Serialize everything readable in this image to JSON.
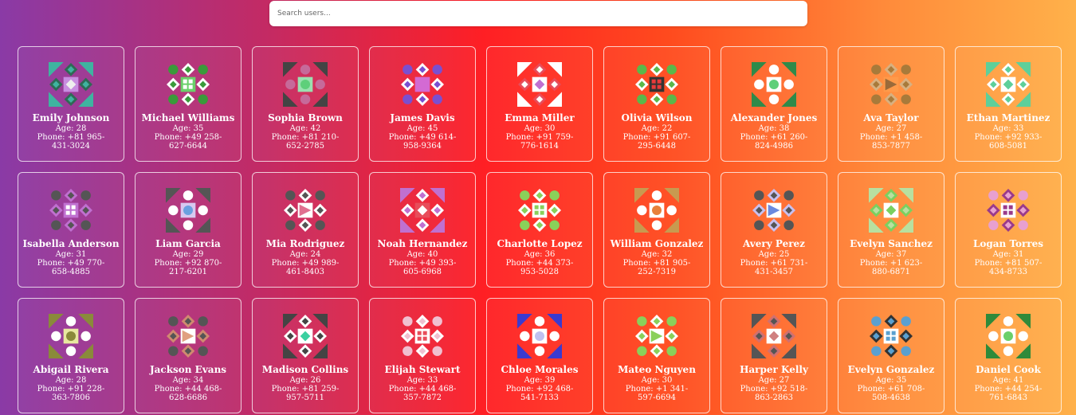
{
  "search": {
    "placeholder": "Search users..."
  },
  "users": [
    {
      "name": "Emily Johnson",
      "age": "Age: 28",
      "phone": "Phone: +81 965-431-3024",
      "colors": [
        "#3fb3a0",
        "#2f6a55",
        "#c88de0",
        "#eeeeee"
      ]
    },
    {
      "name": "Michael Williams",
      "age": "Age: 35",
      "phone": "Phone: +49 258-627-6644",
      "colors": [
        "#3a9a3a",
        "#ffffff",
        "#6bd06b",
        "#ffffff"
      ]
    },
    {
      "name": "Sophia Brown",
      "age": "Age: 42",
      "phone": "Phone: +81 210-652-2785",
      "colors": [
        "#444444",
        "#c66a9a",
        "#9be0b0",
        "#5ecf7a"
      ]
    },
    {
      "name": "James Davis",
      "age": "Age: 45",
      "phone": "Phone: +49 614-958-9364",
      "colors": [
        "#7a4fd0",
        "#ffffff",
        "#d36ad3",
        "#d36ad3"
      ]
    },
    {
      "name": "Emma Miller",
      "age": "Age: 30",
      "phone": "Phone: +91 759-776-1614",
      "colors": [
        "#ffffff",
        "#e84d5a",
        "#ffffff",
        "#c070d0"
      ]
    },
    {
      "name": "Olivia Wilson",
      "age": "Age: 22",
      "phone": "Phone: +91 607-295-6448",
      "colors": [
        "#5ab84a",
        "#ffffff",
        "#333333",
        "#e83a3a"
      ]
    },
    {
      "name": "Alexander Jones",
      "age": "Age: 38",
      "phone": "Phone: +61 260-824-4986",
      "colors": [
        "#2f8a4a",
        "#ffffff",
        "#ffffff",
        "#5ecf7a"
      ]
    },
    {
      "name": "Ava Taylor",
      "age": "Age: 27",
      "phone": "Phone: +1 458-853-7877",
      "colors": [
        "#a87a3a",
        "#d8b080",
        "#ff9a4a",
        "#9a6a3a"
      ]
    },
    {
      "name": "Ethan Martinez",
      "age": "Age: 33",
      "phone": "Phone: +92 933-608-5081",
      "colors": [
        "#5ecf9a",
        "#ffffff",
        "#ffffff",
        "#5ecf9a"
      ]
    },
    {
      "name": "Isabella Anderson",
      "age": "Age: 31",
      "phone": "Phone: +49 770-658-4885",
      "colors": [
        "#555555",
        "#c070d0",
        "#c070d0",
        "#ffffff"
      ]
    },
    {
      "name": "Liam Garcia",
      "age": "Age: 29",
      "phone": "Phone: +92 870-217-6201",
      "colors": [
        "#555555",
        "#ffffff",
        "#d8c8f0",
        "#6aa0e0"
      ]
    },
    {
      "name": "Mia Rodriguez",
      "age": "Age: 24",
      "phone": "Phone: +49 989-461-8403",
      "colors": [
        "#555555",
        "#ffffff",
        "#ffffff",
        "#e07090"
      ]
    },
    {
      "name": "Noah Hernandez",
      "age": "Age: 40",
      "phone": "Phone: +49 393-605-6968",
      "colors": [
        "#c070d0",
        "#ffffff",
        "#e84d5a",
        "#ffffff"
      ]
    },
    {
      "name": "Charlotte Lopez",
      "age": "Age: 36",
      "phone": "Phone: +44 373-953-5028",
      "colors": [
        "#8ad05a",
        "#ffffff",
        "#ffffff",
        "#8ad05a"
      ]
    },
    {
      "name": "William Gonzalez",
      "age": "Age: 32",
      "phone": "Phone: +81 905-252-7319",
      "colors": [
        "#c89a50",
        "#ffffff",
        "#ffffff",
        "#e8803a"
      ]
    },
    {
      "name": "Avery Perez",
      "age": "Age: 25",
      "phone": "Phone: +61 731-431-3457",
      "colors": [
        "#555555",
        "#c8c0f0",
        "#ffffff",
        "#6a8ae0"
      ]
    },
    {
      "name": "Evelyn Sanchez",
      "age": "Age: 37",
      "phone": "Phone: +1 623-880-6871",
      "colors": [
        "#b8e0a0",
        "#7ad060",
        "#ffffff",
        "#7ad060"
      ]
    },
    {
      "name": "Logan Torres",
      "age": "Age: 31",
      "phone": "Phone: +81 507-434-8733",
      "colors": [
        "#e8a0d0",
        "#9a3a8a",
        "#ffffff",
        "#9a3a8a"
      ]
    },
    {
      "name": "Abigail Rivera",
      "age": "Age: 28",
      "phone": "Phone: +91 228-363-7806",
      "colors": [
        "#8a8a3a",
        "#ffffff",
        "#e8e8a0",
        "#8a8a3a"
      ]
    },
    {
      "name": "Jackson Evans",
      "age": "Age: 34",
      "phone": "Phone: +44 468-628-6686",
      "colors": [
        "#555555",
        "#d08a70",
        "#ffffff",
        "#e0a080"
      ]
    },
    {
      "name": "Madison Collins",
      "age": "Age: 26",
      "phone": "Phone: +81 259-957-5711",
      "colors": [
        "#444444",
        "#ffffff",
        "#ffffff",
        "#3ad0a0"
      ]
    },
    {
      "name": "Elijah Stewart",
      "age": "Age: 33",
      "phone": "Phone: +44 468-357-7872",
      "colors": [
        "#f0c0d0",
        "#ffffff",
        "#ffffff",
        "#e84d5a"
      ]
    },
    {
      "name": "Chloe Morales",
      "age": "Age: 39",
      "phone": "Phone: +92 468-541-7133",
      "colors": [
        "#3a3ad0",
        "#ffffff",
        "#ffffff",
        "#c0c0f0"
      ]
    },
    {
      "name": "Mateo Nguyen",
      "age": "Age: 30",
      "phone": "Phone: +1 341-597-6694",
      "colors": [
        "#8ad05a",
        "#ffffff",
        "#ffffff",
        "#8ad05a"
      ]
    },
    {
      "name": "Harper Kelly",
      "age": "Age: 27",
      "phone": "Phone: +92 518-863-2863",
      "colors": [
        "#555555",
        "#d07070",
        "#ffffff",
        "#d08080"
      ]
    },
    {
      "name": "Evelyn Gonzalez",
      "age": "Age: 35",
      "phone": "Phone: +61 708-508-4638",
      "colors": [
        "#5aa0d0",
        "#333333",
        "#ffffff",
        "#5aa0d0"
      ]
    },
    {
      "name": "Daniel Cook",
      "age": "Age: 41",
      "phone": "Phone: +44 254-761-6843",
      "colors": [
        "#2f8a3a",
        "#ffffff",
        "#ffffff",
        "#6ad06a"
      ]
    }
  ]
}
